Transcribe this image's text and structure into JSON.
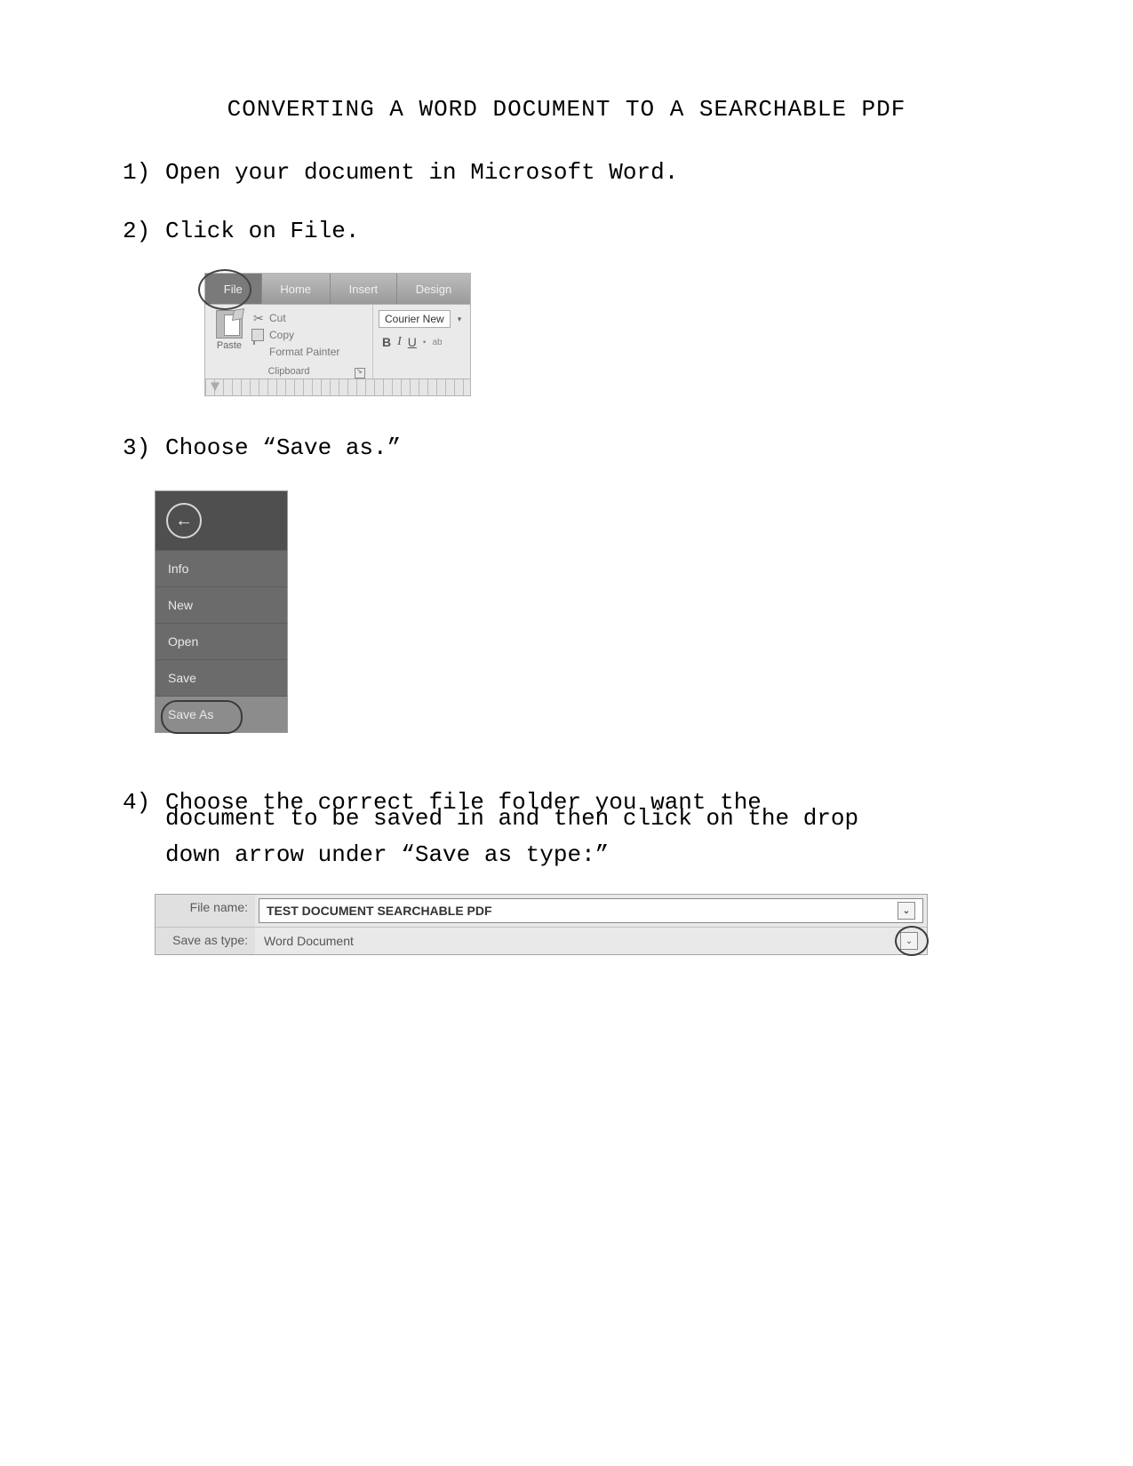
{
  "title": "CONVERTING A WORD DOCUMENT TO A SEARCHABLE PDF",
  "steps": {
    "s1": "Open your document in Microsoft Word.",
    "s2": "Click on File.",
    "s3": "Choose “Save as.”",
    "s4a": "Choose the correct file folder you want the",
    "s4b": "document to be saved in and then click on the drop",
    "s4c": "down arrow under “Save as type:”"
  },
  "ribbon": {
    "tabs": {
      "file": "File",
      "home": "Home",
      "insert": "Insert",
      "design": "Design"
    },
    "paste": "Paste",
    "cut": "Cut",
    "copy": "Copy",
    "format_painter": "Format Painter",
    "clipboard": "Clipboard",
    "font_name": "Courier New",
    "b": "B",
    "i": "I",
    "u": "U",
    "ab": "ab"
  },
  "backstage": {
    "info": "Info",
    "new": "New",
    "open": "Open",
    "save": "Save",
    "save_as": "Save As"
  },
  "savebar": {
    "file_name_label": "File name:",
    "file_name_value": "TEST DOCUMENT SEARCHABLE PDF",
    "save_type_label": "Save as type:",
    "save_type_value": "Word Document"
  }
}
